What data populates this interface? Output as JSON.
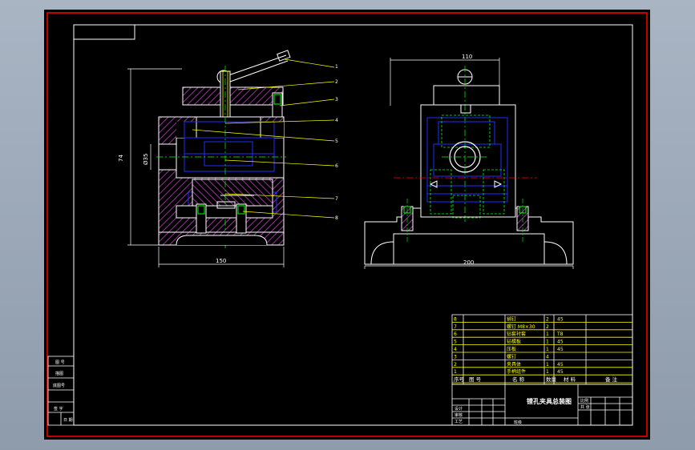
{
  "leader_numbers": [
    "1",
    "2",
    "3",
    "4",
    "5",
    "6",
    "7",
    "8"
  ],
  "front_view": {
    "width_dim": "150",
    "height_dim": "74",
    "bore_dim": "Ø35"
  },
  "side_view": {
    "top_dim": "110",
    "bottom_dim": "200"
  },
  "parts_list": {
    "rows": [
      {
        "no": "8",
        "name": "销钉",
        "qty": "2",
        "material": "45"
      },
      {
        "no": "7",
        "name": "螺钉 M8×30",
        "qty": "2",
        "material": ""
      },
      {
        "no": "6",
        "name": "钻套衬套",
        "qty": "1",
        "material": "T8"
      },
      {
        "no": "5",
        "name": "钻模板",
        "qty": "1",
        "material": "45"
      },
      {
        "no": "4",
        "name": "压板",
        "qty": "1",
        "material": "45"
      },
      {
        "no": "3",
        "name": "螺钉",
        "qty": "4",
        "material": ""
      },
      {
        "no": "2",
        "name": "夹具体",
        "qty": "1",
        "material": "45"
      },
      {
        "no": "1",
        "name": "手柄组件",
        "qty": "1",
        "material": "45"
      }
    ],
    "header": [
      "序号",
      "图 号",
      "名 称",
      "数量",
      "材 料",
      "备 注"
    ]
  },
  "title_block": {
    "title": "镗孔夹具总装图",
    "left_labels": [
      "设计",
      "审核",
      "工艺",
      "批准"
    ],
    "scale_label": "比例",
    "sheet_label": "共 张",
    "school": "班级"
  },
  "margin_labels": [
    "图 号",
    "描图",
    "底图号",
    "签 字",
    "日 期"
  ],
  "colors": {
    "frame": "#ff0000",
    "border": "#ffffff",
    "hatch": "#c040c0",
    "center": "#00ff00",
    "hidden": "#0000ff",
    "leader": "#ffff00",
    "table": "#ffff00"
  }
}
